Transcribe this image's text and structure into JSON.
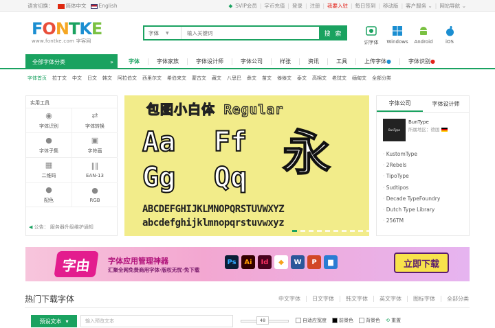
{
  "topbar": {
    "lang_label": "语言切换：",
    "lang_cn": "简体中文",
    "lang_en": "English",
    "links": [
      "SVIP会员",
      "字币充值",
      "登录",
      "注册",
      "我要入驻",
      "每日签到",
      "移动版",
      "客户服务",
      "网站导航"
    ]
  },
  "logo": {
    "text": "FONTKE",
    "sub": "www.fontke.com 字客网"
  },
  "search": {
    "type": "字体",
    "placeholder": "输入关键词",
    "button": "搜 索"
  },
  "apps": [
    {
      "label": "识字体",
      "icon": "font-recognize-icon"
    },
    {
      "label": "Windows",
      "icon": "windows-icon"
    },
    {
      "label": "Android",
      "icon": "android-icon"
    },
    {
      "label": "iOS",
      "icon": "apple-icon"
    }
  ],
  "nav": {
    "all_label": "全部字体分类",
    "items": [
      "字体",
      "字体家族",
      "字体设计师",
      "字体公司",
      "样张",
      "资讯",
      "工具",
      "上传字体",
      "字体识别"
    ]
  },
  "langs": [
    "字体首页",
    "拉丁文",
    "中文",
    "日文",
    "韩文",
    "阿拉伯文",
    "西里尔文",
    "希伯来文",
    "蒙古文",
    "藏文",
    "八思巴",
    "彝文",
    "苗文",
    "傣傣文",
    "泰文",
    "高棉文",
    "老挝文",
    "缅甸文",
    "全部分类"
  ],
  "sidebar": {
    "title": "实用工具",
    "tools": [
      "字体识别",
      "字体转换",
      "字体子集",
      "字符画",
      "二维码",
      "EAN-13",
      "配色",
      "RGB"
    ],
    "notice_label": "公告：",
    "notice_text": "服务器升级维护通知"
  },
  "banner": {
    "title": "包图小白体 Regular",
    "glyphs": [
      "Aa",
      "Ff",
      "Gg",
      "Qq"
    ],
    "yong": "永",
    "upper": "ABCDEFGHIJKLMNOPQRSTUVWXYZ",
    "lower": "abcdefghijklmnopqrstuvwxyz"
  },
  "rpanel": {
    "tabs": [
      "字体公司",
      "字体设计师"
    ],
    "company_name": "BunType",
    "company_logo": "BunType",
    "region": "所属地区：德国",
    "list": [
      "KustomType",
      "2Rebels",
      "TipoType",
      "Sudtipos",
      "Decade TypeFoundry",
      "Dutch Type Library",
      "256TM"
    ]
  },
  "ad": {
    "brand": "字由",
    "line1": "字体应用管理神器",
    "line2": "汇聚全网免费商用字体·版权无忧·免下载",
    "apps": [
      "Ps",
      "Ai",
      "Id",
      "◆",
      "W",
      "P",
      "▆"
    ],
    "download": "立即下载"
  },
  "hot": {
    "title": "热门下载字体",
    "tabs": [
      "中文字体",
      "日文字体",
      "韩文字体",
      "英文字体",
      "图标字体",
      "全部分类"
    ]
  },
  "preview": {
    "button": "预设文本",
    "placeholder": "输入预览文本",
    "size": "48",
    "opts": [
      "自适应宽度",
      "前景色",
      "背景色",
      "重置"
    ]
  },
  "colors": {
    "accent": "#1aa260",
    "red": "#e2231a"
  }
}
